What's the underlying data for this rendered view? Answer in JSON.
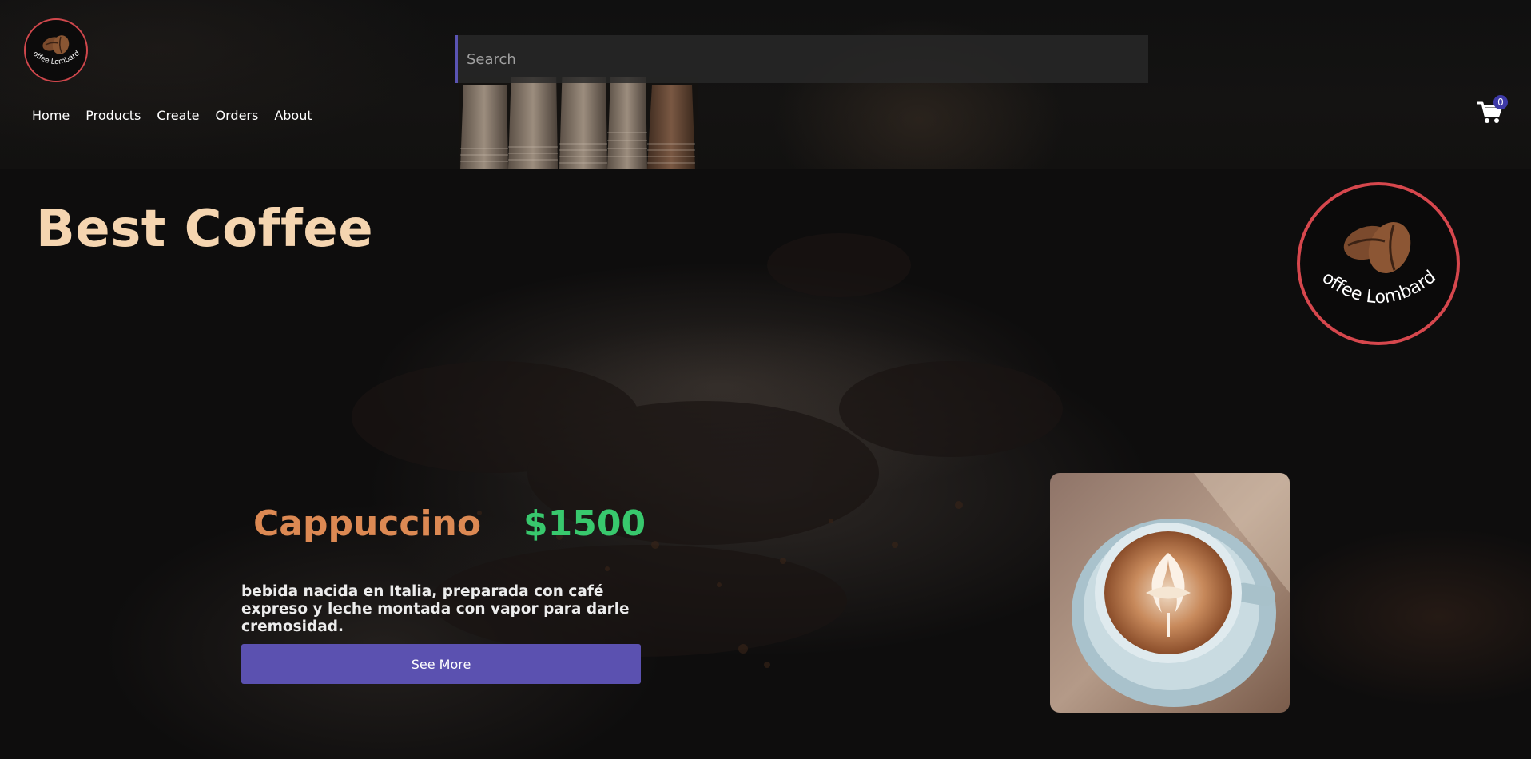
{
  "header": {
    "logo_text": "Coffee Lombardo",
    "search": {
      "placeholder": "Search",
      "value": ""
    },
    "nav": [
      "Home",
      "Products",
      "Create",
      "Orders",
      "About"
    ],
    "cart_count": "0"
  },
  "hero": {
    "title": "Best Coffee",
    "logo_text": "Coffee Lombardo"
  },
  "product": {
    "name": "Cappuccino",
    "price": "$1500",
    "description": "bebida nacida en Italia, preparada con café expreso y leche montada con vapor para darle cremosidad.",
    "button_label": "See More"
  },
  "colors": {
    "logo_ring": "#d6474d",
    "title": "#f5d5b0",
    "product_name": "#dc8953",
    "price": "#38c86d",
    "button": "#5b51b0",
    "badge": "#3e3aa7"
  }
}
